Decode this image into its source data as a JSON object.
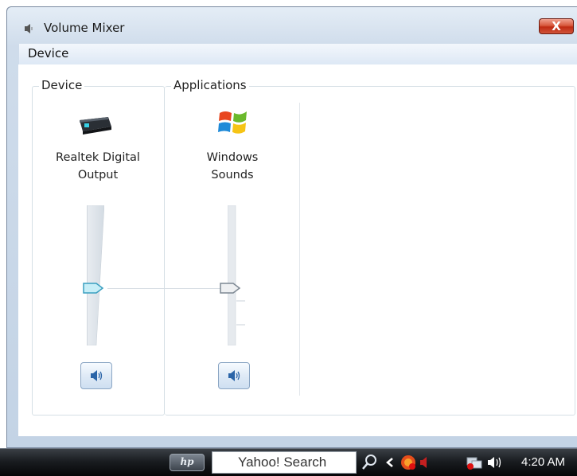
{
  "window": {
    "title": "Volume Mixer",
    "close_label": "X"
  },
  "menu": {
    "items": [
      "Device"
    ]
  },
  "device_group": {
    "label": "Device",
    "device_name_line1": "Realtek Digital",
    "device_name_line2": "Output",
    "volume_level": 0.4
  },
  "applications_group": {
    "label": "Applications",
    "apps": [
      {
        "name_line1": "Windows",
        "name_line2": "Sounds",
        "volume_level": 0.4
      }
    ]
  },
  "taskbar": {
    "start_label": "hp",
    "search_text": "Yahoo! Search",
    "clock": "4:20 AM"
  },
  "colors": {
    "window_frame": "#c3d3e5",
    "taskbar": "#1a1d21",
    "close_button": "#c02b12"
  }
}
